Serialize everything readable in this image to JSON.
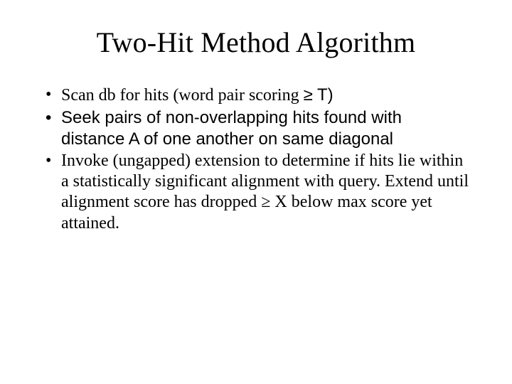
{
  "title": "Two-Hit Method Algorithm",
  "bullets": {
    "b1_a": "Scan db for hits (word pair scoring ",
    "b1_b": "≥ T)",
    "b2": "Seek pairs of non-overlapping hits found with distance A of one another on same diagonal",
    "b3": "Invoke (ungapped) extension to determine if hits lie within a statistically significant alignment with query. Extend until alignment score has dropped ≥ X below max score yet attained."
  }
}
